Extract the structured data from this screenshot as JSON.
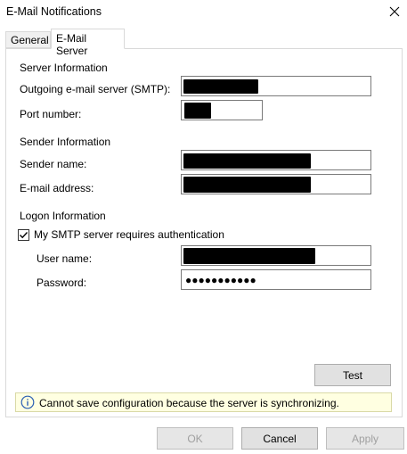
{
  "window": {
    "title": "E-Mail Notifications",
    "close_icon": "close-icon"
  },
  "tabs": [
    {
      "label": "General",
      "active": false
    },
    {
      "label": "E-Mail Server",
      "active": true
    }
  ],
  "server_info": {
    "heading": "Server Information",
    "smtp_label": "Outgoing e-mail server (SMTP):",
    "port_label": "Port number:"
  },
  "sender_info": {
    "heading": "Sender Information",
    "name_label": "Sender name:",
    "email_label": "E-mail address:"
  },
  "logon_info": {
    "heading": "Logon Information",
    "auth_checkbox_label": "My SMTP server requires authentication",
    "auth_checked": true,
    "username_label": "User name:",
    "password_label": "Password:",
    "password_value": "●●●●●●●●●●●"
  },
  "buttons": {
    "test": "Test",
    "ok": "OK",
    "cancel": "Cancel",
    "apply": "Apply"
  },
  "info_message": {
    "icon": "info-icon",
    "text": "Cannot save configuration because the server is synchronizing."
  },
  "colors": {
    "info_bg": "#ffffe1",
    "info_icon": "#2b5fb4"
  }
}
